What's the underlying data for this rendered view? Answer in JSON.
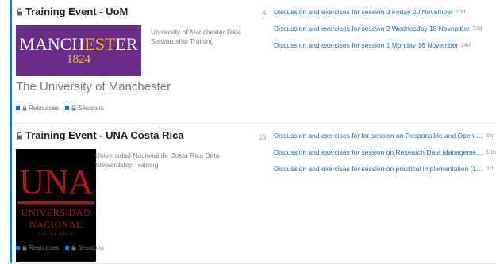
{
  "categories": [
    {
      "title": "Training Event - UoM",
      "logo": {
        "word_a": "MANCH",
        "word_b": "EST",
        "word_c": "ER",
        "year": "1824",
        "caption": "The University of Manchester"
      },
      "description": "University of Manchester Data Stewardship Training",
      "count": "4",
      "links": {
        "resources": "Resources",
        "sessions": "Sessions"
      },
      "topics": [
        {
          "title": "Discussion and exercises for session 3 Friday 20 November",
          "age": "20d"
        },
        {
          "title": "Discussion and exercises for session 2 Wednesday 18 November",
          "age": "22d"
        },
        {
          "title": "Discussion and exercises for session 1 Monday 16 November",
          "age": "24d"
        }
      ]
    },
    {
      "title": "Training Event - UNA Costa Rica",
      "logo": {
        "big": "UNA",
        "line1": "UNIVERSIDAD",
        "line2": "NACIONAL",
        "line3": "COSTA RICA"
      },
      "description": "Universidad Nacional de Costa Rica Data Stewardship Training",
      "count": "10",
      "links": {
        "resources": "Resources",
        "sessions": "Sessions"
      },
      "topics": [
        {
          "title": "Discussion and exercises for for session on Responsible and Open Re...",
          "age": "6h"
        },
        {
          "title": "Discussion and exercises for session on Research Data Management...",
          "age": "19h"
        },
        {
          "title": "Discussion and exercises for session on practical implementation (11th...",
          "age": "1d"
        }
      ]
    }
  ],
  "colors": {
    "accent": "#0a78d0",
    "link": "#1a6fc7",
    "uom_purple": "#6a2d8c",
    "uom_gold": "#f5c518",
    "una_red": "#b2141b"
  }
}
